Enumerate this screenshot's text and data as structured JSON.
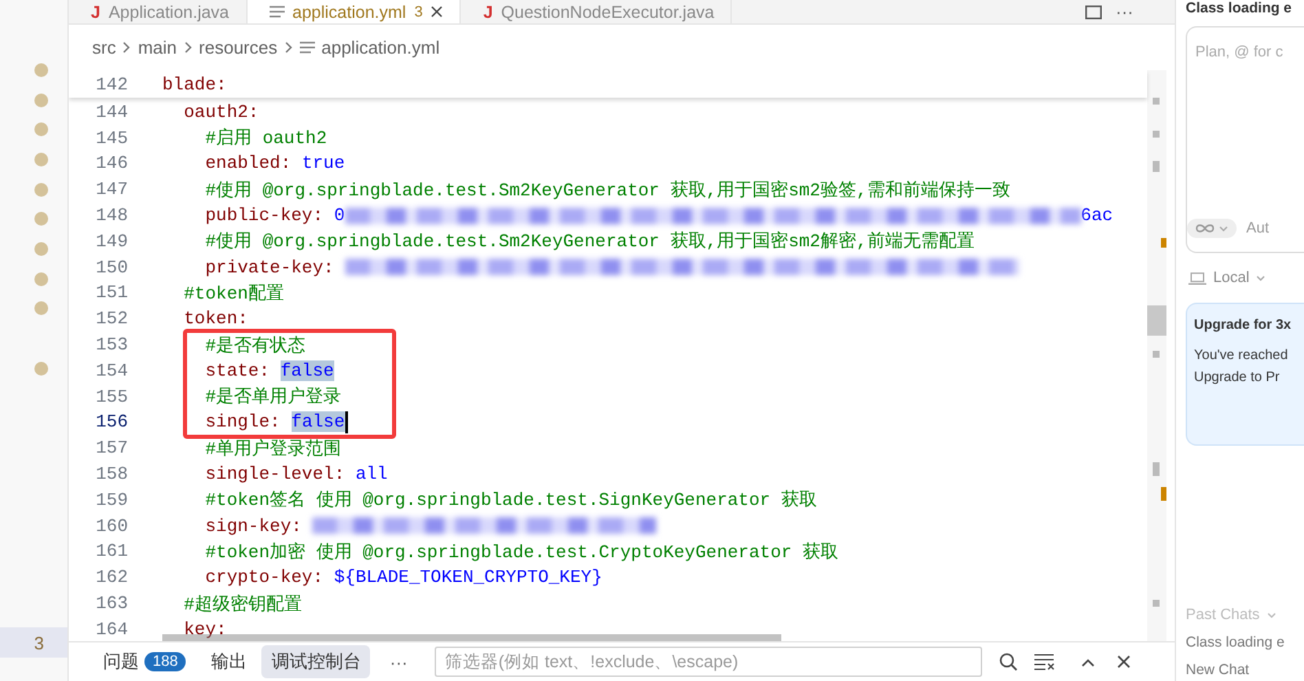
{
  "left_panel": {
    "rows": [
      {
        "dot": true
      },
      {
        "dot": true
      },
      {
        "dot": true
      },
      {
        "dot": true
      },
      {
        "dot": true
      },
      {
        "dot": true
      },
      {
        "dot": true
      },
      {
        "dot": true
      },
      {
        "dot": true
      },
      {
        "dot": false
      },
      {
        "dot": true
      }
    ],
    "footer_count": "3"
  },
  "tabs": [
    {
      "label": "Application.java",
      "kind": "java",
      "icon": "J",
      "selected": false
    },
    {
      "label": "application.yml",
      "kind": "yaml",
      "selected": true,
      "problems": "3"
    },
    {
      "label": "QuestionNodeExecutor.java",
      "kind": "java",
      "icon": "J",
      "selected": false
    }
  ],
  "tab_actions": {
    "more": "···"
  },
  "breadcrumb": [
    {
      "label": "src",
      "kind": "folder"
    },
    {
      "label": "main",
      "kind": "folder"
    },
    {
      "label": "resources",
      "kind": "folder"
    },
    {
      "label": "application.yml",
      "kind": "file"
    }
  ],
  "sticky_line": {
    "number": "142",
    "tokens": [
      {
        "kind": "key",
        "text": "blade:"
      }
    ]
  },
  "lines": [
    {
      "number": "144",
      "current": false,
      "boxed": false,
      "tokens": [
        {
          "kind": "key",
          "text": "  oauth2:"
        }
      ]
    },
    {
      "number": "145",
      "current": false,
      "boxed": false,
      "tokens": [
        {
          "kind": "comment",
          "text": "    #启用 oauth2"
        }
      ]
    },
    {
      "number": "146",
      "current": false,
      "boxed": false,
      "tokens": [
        {
          "kind": "key",
          "text": "    enabled: "
        },
        {
          "kind": "value",
          "text": "true"
        }
      ]
    },
    {
      "number": "147",
      "current": false,
      "boxed": false,
      "tokens": [
        {
          "kind": "comment",
          "text": "    #使用 @org.springblade.test.Sm2KeyGenerator 获取,用于国密sm2验签,需和前端保持一致"
        }
      ]
    },
    {
      "number": "148",
      "current": false,
      "boxed": false,
      "tokens": [
        {
          "kind": "key",
          "text": "    public-key: "
        },
        {
          "kind": "value",
          "text": "0"
        },
        {
          "kind": "redacted"
        },
        {
          "kind": "value",
          "text": "6ac"
        }
      ]
    },
    {
      "number": "149",
      "current": false,
      "boxed": false,
      "tokens": [
        {
          "kind": "comment",
          "text": "    #使用 @org.springblade.test.Sm2KeyGenerator 获取,用于国密sm2解密,前端无需配置"
        }
      ]
    },
    {
      "number": "150",
      "current": false,
      "boxed": false,
      "tokens": [
        {
          "kind": "key",
          "text": "    private-key: "
        },
        {
          "kind": "redacted"
        }
      ]
    },
    {
      "number": "151",
      "current": false,
      "boxed": false,
      "tokens": [
        {
          "kind": "comment",
          "text": "  #token配置"
        }
      ]
    },
    {
      "number": "152",
      "current": false,
      "boxed": false,
      "tokens": [
        {
          "kind": "key",
          "text": "  token:"
        }
      ]
    },
    {
      "number": "153",
      "current": false,
      "boxed": true,
      "tokens": [
        {
          "kind": "comment",
          "text": "    #是否有状态"
        }
      ]
    },
    {
      "number": "154",
      "current": false,
      "boxed": true,
      "tokens": [
        {
          "kind": "key",
          "text": "    state: "
        },
        {
          "kind": "selected",
          "text": "false"
        }
      ]
    },
    {
      "number": "155",
      "current": false,
      "boxed": true,
      "tokens": [
        {
          "kind": "comment",
          "text": "    #是否单用户登录"
        }
      ]
    },
    {
      "number": "156",
      "current": true,
      "boxed": true,
      "tokens": [
        {
          "kind": "key",
          "text": "    single: "
        },
        {
          "kind": "selected",
          "text": "false"
        }
      ]
    },
    {
      "number": "157",
      "current": false,
      "boxed": false,
      "tokens": [
        {
          "kind": "comment",
          "text": "    #单用户登录范围"
        }
      ]
    },
    {
      "number": "158",
      "current": false,
      "boxed": false,
      "tokens": [
        {
          "kind": "key",
          "text": "    single-level: "
        },
        {
          "kind": "value",
          "text": "all"
        }
      ]
    },
    {
      "number": "159",
      "current": false,
      "boxed": false,
      "tokens": [
        {
          "kind": "comment",
          "text": "    #token签名 使用 @org.springblade.test.SignKeyGenerator 获取"
        }
      ]
    },
    {
      "number": "160",
      "current": false,
      "boxed": false,
      "tokens": [
        {
          "kind": "key",
          "text": "    sign-key: "
        },
        {
          "kind": "redacted"
        }
      ]
    },
    {
      "number": "161",
      "current": false,
      "boxed": false,
      "tokens": [
        {
          "kind": "comment",
          "text": "    #token加密 使用 @org.springblade.test.CryptoKeyGenerator 获取"
        }
      ]
    },
    {
      "number": "162",
      "current": false,
      "boxed": false,
      "tokens": [
        {
          "kind": "key",
          "text": "    crypto-key: "
        },
        {
          "kind": "value",
          "text": "${BLADE_TOKEN_CRYPTO_KEY}"
        }
      ]
    },
    {
      "number": "163",
      "current": false,
      "boxed": false,
      "tokens": [
        {
          "kind": "comment",
          "text": "  #超级密钥配置"
        }
      ]
    },
    {
      "number": "164",
      "current": false,
      "boxed": false,
      "tokens": [
        {
          "kind": "key",
          "text": "  key:"
        }
      ]
    }
  ],
  "panel": {
    "tabs": [
      {
        "label": "问题",
        "badge": "188",
        "selected": false
      },
      {
        "label": "输出",
        "selected": false
      },
      {
        "label": "调试控制台",
        "selected": true
      }
    ],
    "more": "···",
    "filter": {
      "placeholder": "筛选器(例如 text、!exclude、\\escape)"
    }
  },
  "chat": {
    "title": "Class loading e",
    "input": {
      "placeholder": "Plan, @ for c"
    },
    "mode": "Aut",
    "location": "Local",
    "upgrade": {
      "title": "Upgrade for 3x",
      "lines": [
        "You've reached",
        "Upgrade to Pr"
      ]
    },
    "past_chats": "Past Chats",
    "history": [
      "Class loading e",
      "New Chat"
    ]
  }
}
